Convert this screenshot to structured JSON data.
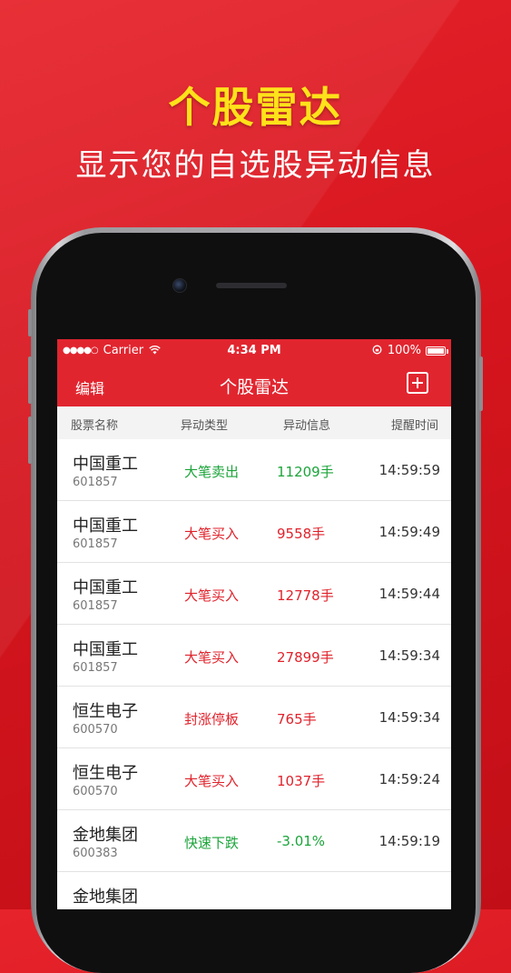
{
  "promo": {
    "headline": "个股雷达",
    "subline": "显示您的自选股异动信息"
  },
  "status_bar": {
    "signal": "●●●●○",
    "carrier": "Carrier",
    "time": "4:34 PM",
    "battery": "100%"
  },
  "nav": {
    "edit_label": "编辑",
    "title": "个股雷达"
  },
  "columns": {
    "name": "股票名称",
    "type": "异动类型",
    "info": "异动信息",
    "time": "提醒时间"
  },
  "rows": [
    {
      "name": "中国重工",
      "code": "601857",
      "type": "大笔卖出",
      "info": "11209手",
      "time": "14:59:59",
      "color": "#1ba43a"
    },
    {
      "name": "中国重工",
      "code": "601857",
      "type": "大笔买入",
      "info": "9558手",
      "time": "14:59:49",
      "color": "#e0222b"
    },
    {
      "name": "中国重工",
      "code": "601857",
      "type": "大笔买入",
      "info": "12778手",
      "time": "14:59:44",
      "color": "#e0222b"
    },
    {
      "name": "中国重工",
      "code": "601857",
      "type": "大笔买入",
      "info": "27899手",
      "time": "14:59:34",
      "color": "#e0222b"
    },
    {
      "name": "恒生电子",
      "code": "600570",
      "type": "封涨停板",
      "info": "765手",
      "time": "14:59:34",
      "color": "#e0222b"
    },
    {
      "name": "恒生电子",
      "code": "600570",
      "type": "大笔买入",
      "info": "1037手",
      "time": "14:59:24",
      "color": "#e0222b"
    },
    {
      "name": "金地集团",
      "code": "600383",
      "type": "快速下跌",
      "info": "-3.01%",
      "time": "14:59:19",
      "color": "#1ba43a"
    },
    {
      "name": "金地集团",
      "code": "",
      "type": "",
      "info": "",
      "time": "",
      "color": "#1ba43a"
    }
  ],
  "colors": {
    "brand_red": "#e1252f",
    "headline_yellow": "#ffe21a",
    "sell_green": "#1ba43a",
    "buy_red": "#e0222b"
  }
}
